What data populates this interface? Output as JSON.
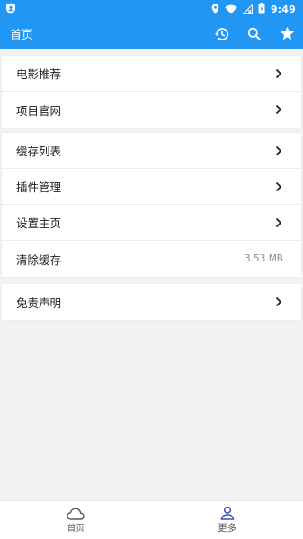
{
  "status_bar": {
    "time": "9:49",
    "icons": [
      "shield-icon",
      "location-icon",
      "wifi-icon",
      "signal-icon",
      "battery-icon"
    ]
  },
  "app_bar": {
    "title": "首页",
    "actions": [
      "history-icon",
      "search-icon",
      "star-icon"
    ]
  },
  "groups": [
    {
      "items": [
        {
          "label": "电影推荐",
          "value": null,
          "icon": "chevron-right-icon"
        },
        {
          "label": "项目官网",
          "value": null,
          "icon": "chevron-right-icon"
        }
      ]
    },
    {
      "items": [
        {
          "label": "缓存列表",
          "value": null,
          "icon": "chevron-right-icon"
        },
        {
          "label": "插件管理",
          "value": null,
          "icon": "chevron-right-icon"
        },
        {
          "label": "设置主页",
          "value": null,
          "icon": "chevron-right-icon"
        },
        {
          "label": "清除缓存",
          "value": "3.53 MB",
          "icon": null
        }
      ]
    },
    {
      "items": [
        {
          "label": "免责声明",
          "value": null,
          "icon": "chevron-right-icon"
        }
      ]
    }
  ],
  "bottom_nav": {
    "tabs": [
      {
        "label": "首页",
        "icon": "cloud-icon",
        "active": false
      },
      {
        "label": "更多",
        "icon": "person-icon",
        "active": true
      }
    ]
  },
  "colors": {
    "primary": "#2196f3",
    "background": "#f2f2f2",
    "active_tab": "#3f51b5"
  }
}
